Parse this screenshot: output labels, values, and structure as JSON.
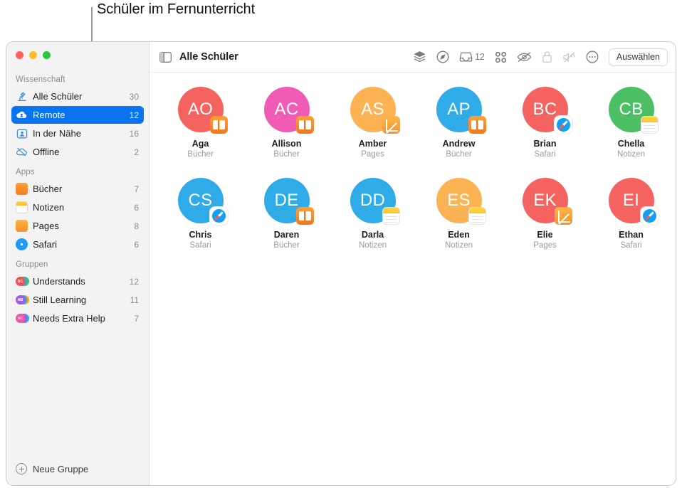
{
  "callout": {
    "text": "Schüler im Fernunterricht"
  },
  "window": {
    "traffic_lights": [
      "close",
      "minimize",
      "zoom"
    ]
  },
  "sidebar": {
    "sections": [
      {
        "header": "Wissenschaft",
        "items": [
          {
            "label": "Alle Schüler",
            "count": "30",
            "icon": "microscope-icon",
            "selected": false
          },
          {
            "label": "Remote",
            "count": "12",
            "icon": "cloud-person-icon",
            "selected": true
          },
          {
            "label": "In der Nähe",
            "count": "16",
            "icon": "person-frame-icon",
            "selected": false
          },
          {
            "label": "Offline",
            "count": "2",
            "icon": "cloud-slash-icon",
            "selected": false
          }
        ]
      },
      {
        "header": "Apps",
        "items": [
          {
            "label": "Bücher",
            "count": "7",
            "icon": "books-app-icon",
            "selected": false
          },
          {
            "label": "Notizen",
            "count": "6",
            "icon": "notes-app-icon",
            "selected": false
          },
          {
            "label": "Pages",
            "count": "8",
            "icon": "pages-app-icon",
            "selected": false
          },
          {
            "label": "Safari",
            "count": "6",
            "icon": "safari-app-icon",
            "selected": false
          }
        ]
      },
      {
        "header": "Gruppen",
        "items": [
          {
            "label": "Understands",
            "count": "12",
            "icon": "group-avatars-icon",
            "selected": false,
            "colors": [
              "#f0524c",
              "#3aa0e8",
              "#3fc060"
            ]
          },
          {
            "label": "Still Learning",
            "count": "11",
            "icon": "group-avatars-icon",
            "selected": false,
            "colors": [
              "#a05ce0",
              "#3aa0e8",
              "#f5a623"
            ]
          },
          {
            "label": "Needs Extra Help",
            "count": "7",
            "icon": "group-avatars-icon",
            "selected": false,
            "colors": [
              "#f055a8",
              "#a05ce0",
              "#3aa0e8"
            ]
          }
        ]
      }
    ],
    "new_group_label": "Neue Gruppe"
  },
  "toolbar": {
    "sidebar_toggle_icon": "sidebar-toggle-icon",
    "title": "Alle Schüler",
    "actions": [
      {
        "name": "layers-icon",
        "label": "Bildschirme",
        "disabled": false
      },
      {
        "name": "navigate-compass-icon",
        "label": "Navigieren",
        "disabled": false
      },
      {
        "name": "inbox-icon",
        "label": "Posteingang",
        "disabled": false,
        "count": "12"
      },
      {
        "name": "grid-view-icon",
        "label": "Raster",
        "disabled": false
      },
      {
        "name": "eye-slash-icon",
        "label": "Bildschirm verbergen",
        "disabled": false
      },
      {
        "name": "lock-icon",
        "label": "Sperren",
        "disabled": true
      },
      {
        "name": "speaker-slash-icon",
        "label": "Stumm",
        "disabled": true
      },
      {
        "name": "more-ellipsis-icon",
        "label": "Weitere Aktionen",
        "disabled": false
      }
    ],
    "select_button": "Auswählen"
  },
  "students": [
    {
      "initials": "AO",
      "name": "Aga",
      "app": "Bücher",
      "color": "#f4635f",
      "badge": "books"
    },
    {
      "initials": "AC",
      "name": "Allison",
      "app": "Bücher",
      "color": "#f05cb5",
      "badge": "books"
    },
    {
      "initials": "AS",
      "name": "Amber",
      "app": "Pages",
      "color": "#fbb252",
      "badge": "pages"
    },
    {
      "initials": "AP",
      "name": "Andrew",
      "app": "Bücher",
      "color": "#2fabe8",
      "badge": "books"
    },
    {
      "initials": "BC",
      "name": "Brian",
      "app": "Safari",
      "color": "#f4635f",
      "badge": "safari"
    },
    {
      "initials": "CB",
      "name": "Chella",
      "app": "Notizen",
      "color": "#4cbf65",
      "badge": "notes"
    },
    {
      "initials": "CS",
      "name": "Chris",
      "app": "Safari",
      "color": "#2fabe8",
      "badge": "safari"
    },
    {
      "initials": "DE",
      "name": "Daren",
      "app": "Bücher",
      "color": "#2fabe8",
      "badge": "books"
    },
    {
      "initials": "DD",
      "name": "Darla",
      "app": "Notizen",
      "color": "#2fabe8",
      "badge": "notes"
    },
    {
      "initials": "ES",
      "name": "Eden",
      "app": "Notizen",
      "color": "#fbb252",
      "badge": "notes"
    },
    {
      "initials": "EK",
      "name": "Elie",
      "app": "Pages",
      "color": "#f4635f",
      "badge": "pages"
    },
    {
      "initials": "EI",
      "name": "Ethan",
      "app": "Safari",
      "color": "#f4635f",
      "badge": "safari"
    }
  ],
  "colors": {
    "accent": "#0a74f0",
    "sidebar_bg": "#f3f3f3",
    "muted_text": "#8c8c8c"
  }
}
